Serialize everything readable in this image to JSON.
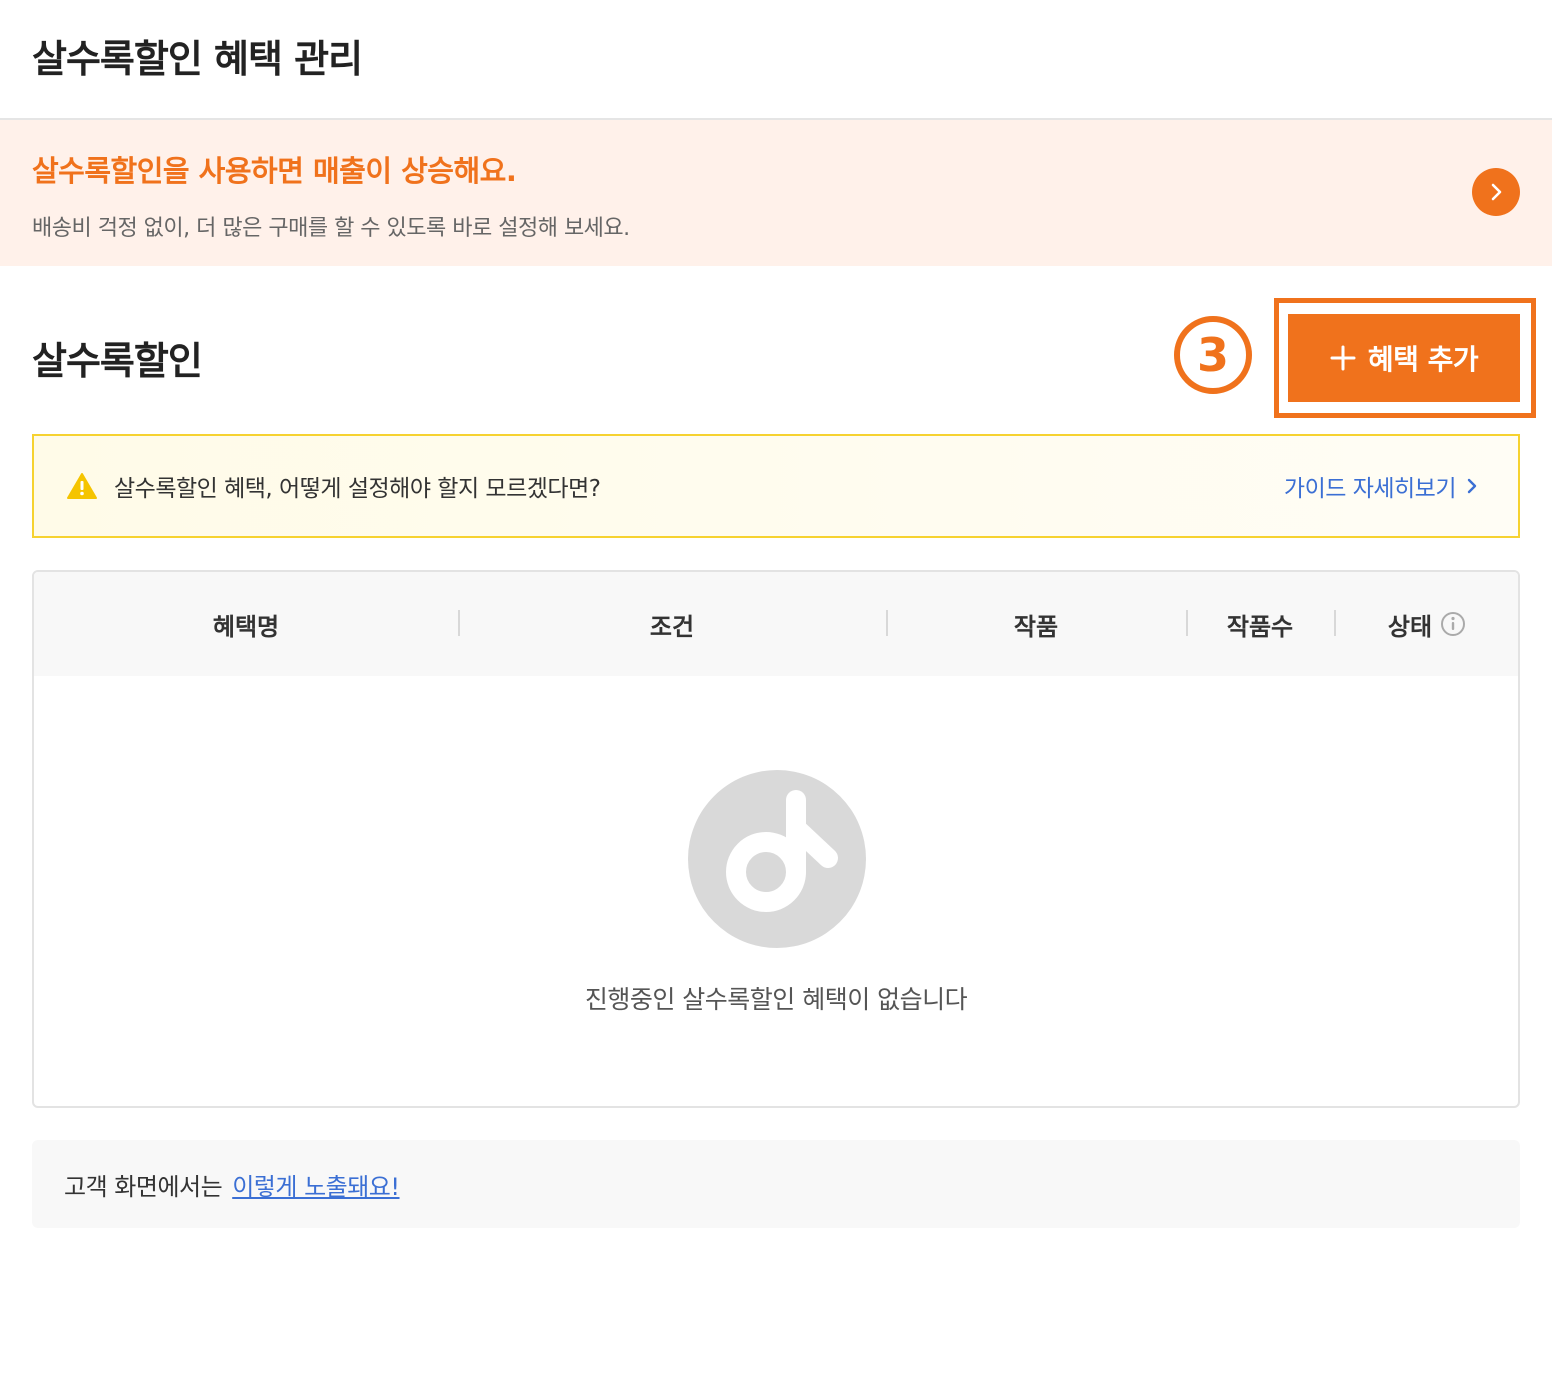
{
  "header": {
    "title": "살수록할인 혜택 관리"
  },
  "promo": {
    "title": "살수록할인을 사용하면 매출이 상승해요.",
    "description": "배송비 걱정 없이, 더 많은 구매를 할 수 있도록 바로 설정해 보세요.",
    "arrow_icon": "chevron-right-icon"
  },
  "section": {
    "title": "살수록할인",
    "step_marker": "3",
    "add_button_label": "혜택 추가",
    "add_button_icon": "plus-icon"
  },
  "guide": {
    "text": "살수록할인 혜택, 어떻게 설정해야 할지 모르겠다면?",
    "link_label": "가이드 자세히보기",
    "warning_icon": "warning-icon"
  },
  "table": {
    "columns": [
      "혜택명",
      "조건",
      "작품",
      "작품수",
      "상태"
    ],
    "status_info_icon": "info-icon",
    "empty_message": "진행중인 살수록할인 혜택이 없습니다"
  },
  "customer_view": {
    "text": "고객 화면에서는",
    "link_label": "이렇게 노출돼요!"
  },
  "colors": {
    "accent": "#f0721c",
    "promo_bg": "#fff1ea",
    "guide_border": "#f6d230",
    "link": "#3b6fd4",
    "warning": "#f5c400"
  }
}
